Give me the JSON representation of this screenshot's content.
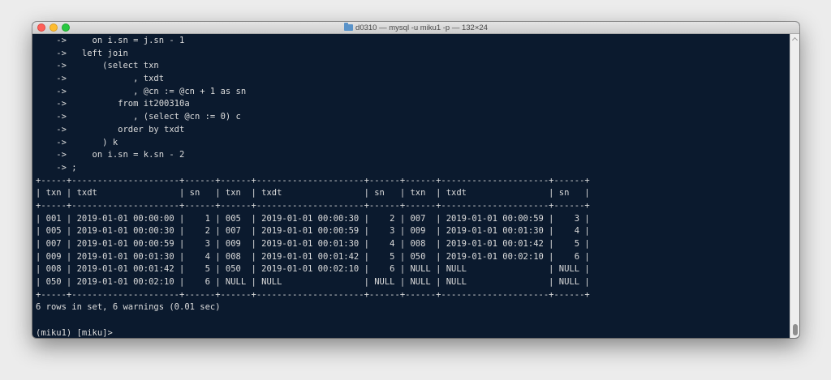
{
  "window": {
    "title": "d0310 — mysql -u miku1 -p — 132×24"
  },
  "terminal": {
    "lines": [
      "    ->     on i.sn = j.sn - 1",
      "    ->   left join",
      "    ->       (select txn",
      "    ->             , txdt",
      "    ->             , @cn := @cn + 1 as sn",
      "    ->          from it200310a",
      "    ->             , (select @cn := 0) c",
      "    ->          order by txdt",
      "    ->       ) k",
      "    ->     on i.sn = k.sn - 2",
      "    -> ;",
      "+-----+---------------------+------+------+---------------------+------+------+---------------------+------+",
      "| txn | txdt                | sn   | txn  | txdt                | sn   | txn  | txdt                | sn   |",
      "+-----+---------------------+------+------+---------------------+------+------+---------------------+------+",
      "| 001 | 2019-01-01 00:00:00 |    1 | 005  | 2019-01-01 00:00:30 |    2 | 007  | 2019-01-01 00:00:59 |    3 |",
      "| 005 | 2019-01-01 00:00:30 |    2 | 007  | 2019-01-01 00:00:59 |    3 | 009  | 2019-01-01 00:01:30 |    4 |",
      "| 007 | 2019-01-01 00:00:59 |    3 | 009  | 2019-01-01 00:01:30 |    4 | 008  | 2019-01-01 00:01:42 |    5 |",
      "| 009 | 2019-01-01 00:01:30 |    4 | 008  | 2019-01-01 00:01:42 |    5 | 050  | 2019-01-01 00:02:10 |    6 |",
      "| 008 | 2019-01-01 00:01:42 |    5 | 050  | 2019-01-01 00:02:10 |    6 | NULL | NULL                | NULL |",
      "| 050 | 2019-01-01 00:02:10 |    6 | NULL | NULL                | NULL | NULL | NULL                | NULL |",
      "+-----+---------------------+------+------+---------------------+------+------+---------------------+------+",
      "6 rows in set, 6 warnings (0.01 sec)",
      "",
      "(miku1) [miku]> "
    ]
  }
}
